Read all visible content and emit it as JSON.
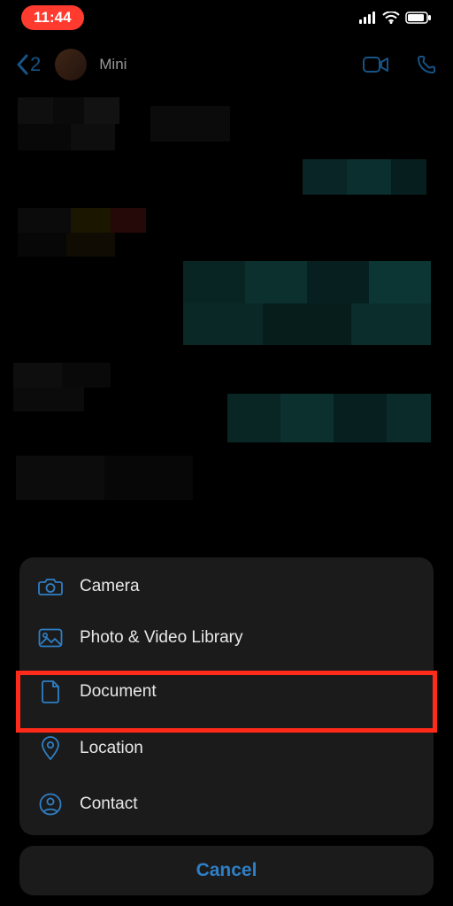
{
  "statusbar": {
    "time": "11:44"
  },
  "header": {
    "back_count": "2",
    "contact_name": "Mini"
  },
  "sheet": {
    "items": [
      {
        "label": "Camera",
        "icon": "camera-icon"
      },
      {
        "label": "Photo & Video Library",
        "icon": "photo-icon"
      },
      {
        "label": "Document",
        "icon": "document-icon",
        "highlighted": true
      },
      {
        "label": "Location",
        "icon": "location-icon"
      },
      {
        "label": "Contact",
        "icon": "contact-icon"
      }
    ],
    "cancel_label": "Cancel"
  }
}
